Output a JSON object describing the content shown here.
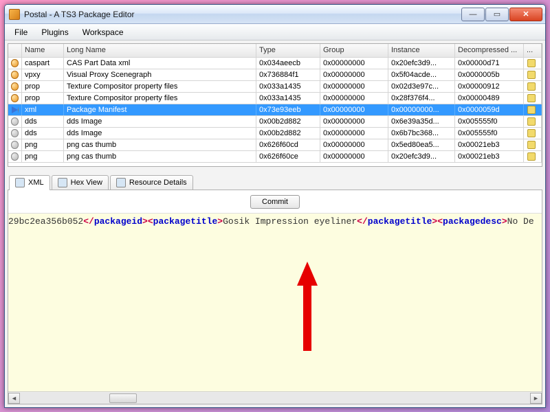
{
  "window": {
    "title": "Postal - A TS3 Package Editor"
  },
  "menu": [
    "File",
    "Plugins",
    "Workspace"
  ],
  "grid": {
    "headers": {
      "name": "Name",
      "long": "Long Name",
      "type": "Type",
      "group": "Group",
      "instance": "Instance",
      "decomp": "Decompressed ...",
      "end": "..."
    },
    "rows": [
      {
        "icon": "orange",
        "name": "caspart",
        "long": "CAS Part Data xml",
        "type": "0x034aeecb",
        "group": "0x00000000",
        "instance": "0x20efc3d9...",
        "decomp": "0x00000d71",
        "selected": false
      },
      {
        "icon": "orange",
        "name": "vpxy",
        "long": "Visual Proxy Scenegraph",
        "type": "0x736884f1",
        "group": "0x00000000",
        "instance": "0x5f04acde...",
        "decomp": "0x0000005b",
        "selected": false
      },
      {
        "icon": "orange",
        "name": "prop",
        "long": "Texture Compositor property files",
        "type": "0x033a1435",
        "group": "0x00000000",
        "instance": "0x02d3e97c...",
        "decomp": "0x00000912",
        "selected": false
      },
      {
        "icon": "orange",
        "name": "prop",
        "long": "Texture Compositor property files",
        "type": "0x033a1435",
        "group": "0x00000000",
        "instance": "0x28f376f4...",
        "decomp": "0x00000489",
        "selected": false
      },
      {
        "icon": "arrow",
        "name": "xml",
        "long": "Package Manifest",
        "type": "0x73e93eeb",
        "group": "0x00000000",
        "instance": "0x00000000...",
        "decomp": "0x0000059d",
        "selected": true
      },
      {
        "icon": "gray",
        "name": "dds",
        "long": "dds Image",
        "type": "0x00b2d882",
        "group": "0x00000000",
        "instance": "0x6e39a35d...",
        "decomp": "0x005555f0",
        "selected": false
      },
      {
        "icon": "gray",
        "name": "dds",
        "long": "dds Image",
        "type": "0x00b2d882",
        "group": "0x00000000",
        "instance": "0x6b7bc368...",
        "decomp": "0x005555f0",
        "selected": false
      },
      {
        "icon": "gray",
        "name": "png",
        "long": "png cas thumb",
        "type": "0x626f60cd",
        "group": "0x00000000",
        "instance": "0x5ed80ea5...",
        "decomp": "0x00021eb3",
        "selected": false
      },
      {
        "icon": "gray",
        "name": "png",
        "long": "png cas thumb",
        "type": "0x626f60ce",
        "group": "0x00000000",
        "instance": "0x20efc3d9...",
        "decomp": "0x00021eb3",
        "selected": false
      }
    ]
  },
  "tabs": {
    "items": [
      {
        "label": "XML",
        "active": true
      },
      {
        "label": "Hex View",
        "active": false
      },
      {
        "label": "Resource Details",
        "active": false
      }
    ],
    "commit": "Commit"
  },
  "xml": {
    "seg1_text": "29bc2ea356b052",
    "seg1_close": "packageid",
    "seg2_open": "packagetitle",
    "seg2_text": "Gosik Impression eyeliner",
    "seg2_close": "packagetitle",
    "seg3_open": "packagedesc",
    "seg3_text": "No De"
  }
}
